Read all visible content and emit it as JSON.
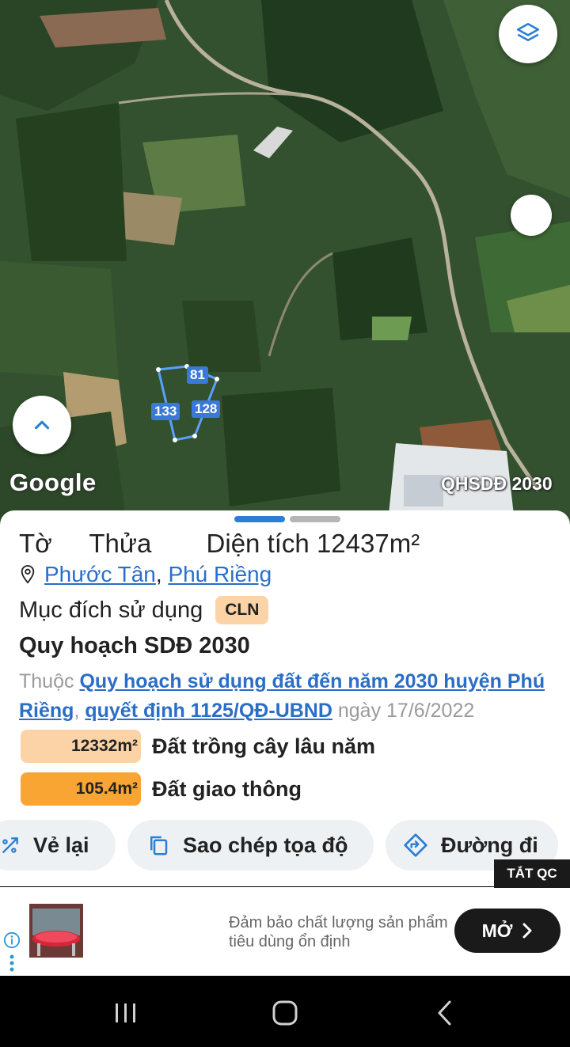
{
  "map": {
    "google_label": "Google",
    "tag": "QHSDĐ 2030",
    "plot_numbers": [
      "81",
      "133",
      "128"
    ]
  },
  "info": {
    "sheet_label": "Tờ",
    "parcel_label": "Thửa",
    "area_label": "Diện tích",
    "area_value": "12437m²",
    "location": {
      "ward": "Phước Tân",
      "separator": ",",
      "district": "Phú Riềng"
    },
    "purpose_label": "Mục đích sử dụng",
    "purpose_code": "CLN",
    "plan_title": "Quy hoạch SDĐ 2030",
    "belongs_prefix": "Thuộc",
    "plan_link": "Quy hoạch sử dụng đất đến năm 2030 huyện Phú Riềng",
    "belongs_sep": ",",
    "decision_link": "quyết định 1125/QĐ-UBND",
    "decision_date": "ngày 17/6/2022",
    "land_uses": [
      {
        "amount": "12332m²",
        "name": "Đất trồng cây lâu năm",
        "color": "#fcd3a6"
      },
      {
        "amount": "105.4m²",
        "name": "Đất giao thông",
        "color": "#f9a534"
      }
    ]
  },
  "actions": {
    "redraw": "Vẻ lại",
    "copy_coords": "Sao chép tọa độ",
    "directions": "Đường đi"
  },
  "ad": {
    "hide_label": "TẮT QC",
    "line1": "Đảm bảo chất lượng sản phẩm",
    "line2": "tiêu dùng ổn định",
    "open_label": "MỞ"
  },
  "colors": {
    "accent": "#2a6ec7",
    "plot": "#3b79d9",
    "pager_active": "#2a7fd4",
    "pager_inactive": "#b5b5b5"
  }
}
